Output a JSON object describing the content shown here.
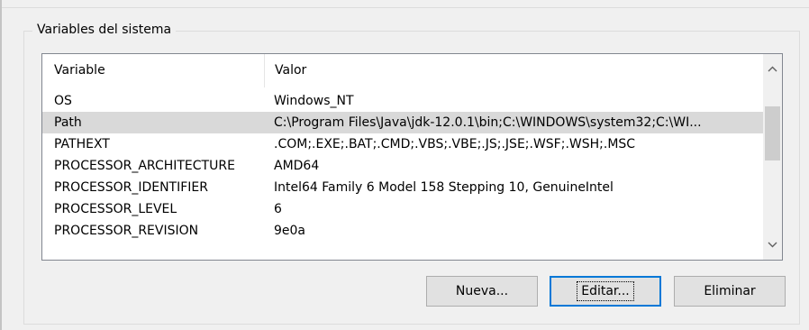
{
  "group": {
    "title": "Variables del sistema"
  },
  "list": {
    "columns": {
      "variable": "Variable",
      "value": "Valor"
    },
    "rows": [
      {
        "variable": "OS",
        "value": "Windows_NT"
      },
      {
        "variable": "Path",
        "value": "C:\\Program Files\\Java\\jdk-12.0.1\\bin;C:\\WINDOWS\\system32;C:\\WI..."
      },
      {
        "variable": "PATHEXT",
        "value": ".COM;.EXE;.BAT;.CMD;.VBS;.VBE;.JS;.JSE;.WSF;.WSH;.MSC"
      },
      {
        "variable": "PROCESSOR_ARCHITECTURE",
        "value": "AMD64"
      },
      {
        "variable": "PROCESSOR_IDENTIFIER",
        "value": "Intel64 Family 6 Model 158 Stepping 10, GenuineIntel"
      },
      {
        "variable": "PROCESSOR_LEVEL",
        "value": "6"
      },
      {
        "variable": "PROCESSOR_REVISION",
        "value": "9e0a"
      }
    ],
    "selected_index": 1
  },
  "scrollbar": {
    "up_icon": "chevron-up-icon",
    "down_icon": "chevron-down-icon"
  },
  "buttons": {
    "new_label": "Nueva...",
    "edit_label": "Editar...",
    "delete_label": "Eliminar"
  },
  "colors": {
    "selection": "#d9d9d9",
    "focus_border": "#0078d7"
  }
}
